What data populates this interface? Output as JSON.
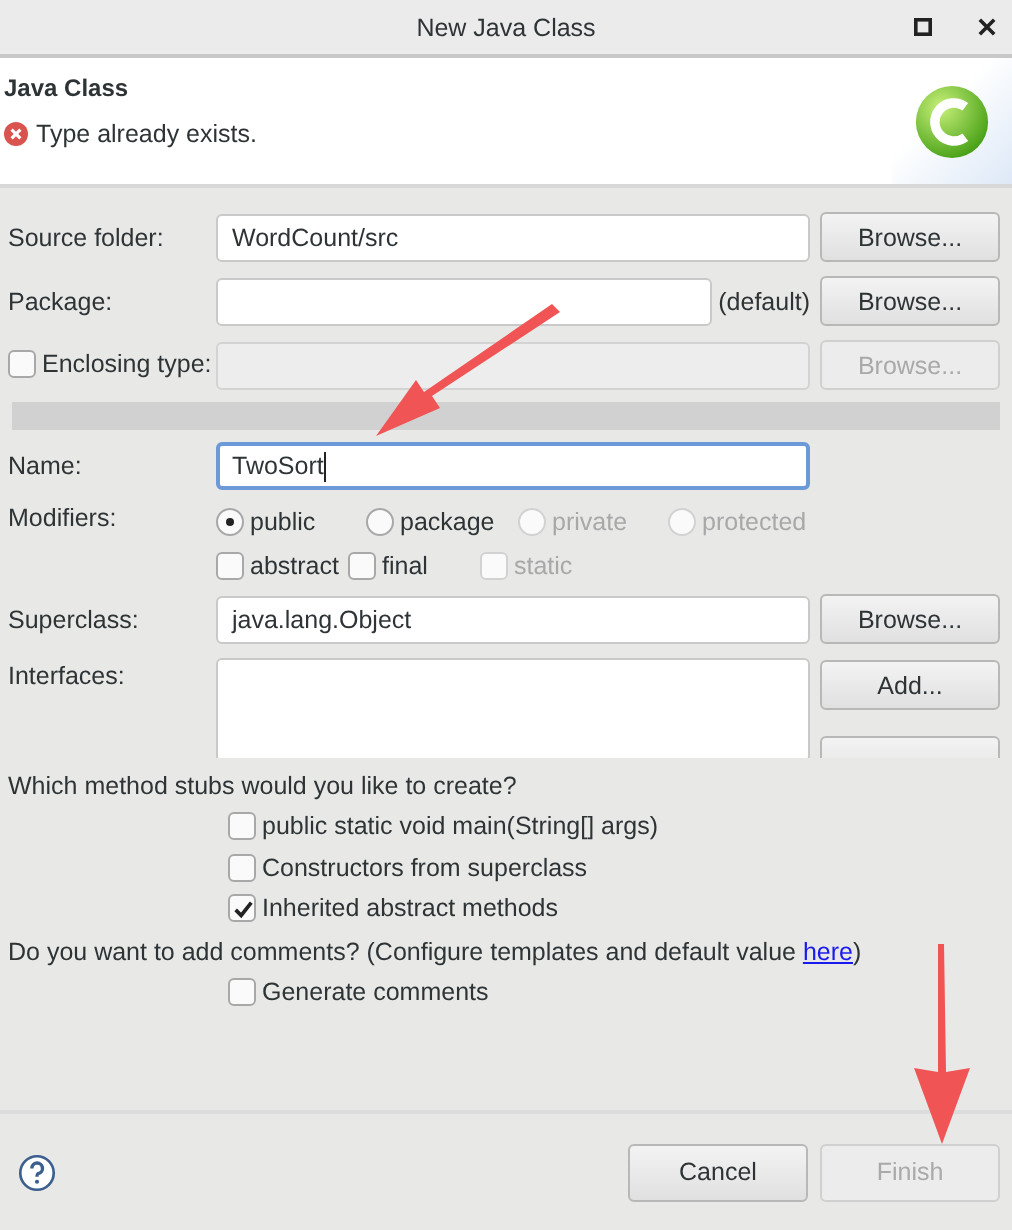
{
  "window": {
    "title": "New Java Class"
  },
  "header": {
    "title": "Java Class",
    "message": {
      "kind": "error",
      "text": "Type already exists."
    }
  },
  "source_folder": {
    "label": "Source folder:",
    "value": "WordCount/src",
    "button": {
      "label": "Browse...",
      "disabled": false
    }
  },
  "package": {
    "label": "Package:",
    "suffix": "(default)",
    "button": {
      "label": "Browse...",
      "disabled": false
    }
  },
  "enclosing_type": {
    "label": "Enclosing type:",
    "checked": false,
    "disabled": true,
    "button": {
      "label": "Browse...",
      "disabled": true
    }
  },
  "name": {
    "label": "Name:",
    "value": "TwoSort",
    "focused": true
  },
  "modifiers": {
    "label": "Modifiers:",
    "access": [
      {
        "label": "public",
        "selected": true,
        "disabled": false
      },
      {
        "label": "package",
        "selected": false,
        "disabled": false
      },
      {
        "label": "private",
        "selected": false,
        "disabled": true
      },
      {
        "label": "protected",
        "selected": false,
        "disabled": true
      }
    ],
    "flags": [
      {
        "label": "abstract",
        "checked": false,
        "disabled": false
      },
      {
        "label": "final",
        "checked": false,
        "disabled": false
      },
      {
        "label": "static",
        "checked": false,
        "disabled": true
      }
    ]
  },
  "superclass": {
    "label": "Superclass:",
    "value": "java.lang.Object",
    "button": {
      "label": "Browse...",
      "disabled": false
    }
  },
  "interfaces": {
    "label": "Interfaces:",
    "button": {
      "label": "Add...",
      "disabled": false
    }
  },
  "method_stubs": {
    "question": "Which method stubs would you like to create?",
    "options": [
      {
        "label": "public static void main(String[] args)",
        "checked": false
      },
      {
        "label": "Constructors from superclass",
        "checked": false
      },
      {
        "label": "Inherited abstract methods",
        "checked": true
      }
    ]
  },
  "comments": {
    "question": "Do you want to add comments? (Configure templates and default value ",
    "link": "here",
    "after": ")",
    "options": [
      {
        "label": "Generate comments",
        "checked": false
      }
    ]
  },
  "buttons": [
    {
      "label": "Cancel",
      "disabled": false
    },
    {
      "label": "Finish",
      "disabled": true
    }
  ]
}
